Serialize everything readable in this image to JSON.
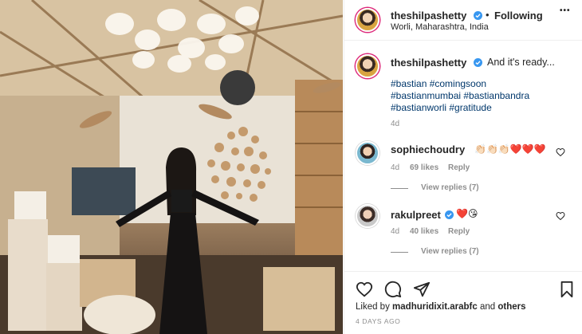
{
  "post": {
    "username": "theshilpashetty",
    "separator": "•",
    "follow_status": "Following",
    "location": "Worli, Maharashtra, India",
    "more_label": "•••"
  },
  "caption": {
    "username": "theshilpashetty",
    "text": "And it's ready...",
    "hashtags_line1": "#bastian #comingsoon",
    "hashtags_line2": "#bastianmumbai #bastianbandra",
    "hashtags_line3": "#bastianworli #gratitude",
    "age": "4d"
  },
  "comments": [
    {
      "username": "sophiechoudry",
      "text": "👏🏻👏🏻👏🏻❤️❤️❤️",
      "age": "4d",
      "likes": "69 likes",
      "reply": "Reply",
      "view_replies": "View replies (7)"
    },
    {
      "username": "rakulpreet",
      "text": "❤️😘",
      "age": "4d",
      "likes": "40 likes",
      "reply": "Reply",
      "view_replies": "View replies (7)"
    }
  ],
  "footer": {
    "liked_by_prefix": "Liked by",
    "liked_by_user": "madhuridixit.arabfc",
    "liked_by_and": "and",
    "liked_by_others": "others",
    "time_ago": "4 DAYS AGO"
  },
  "icons": {
    "verified": "verified-badge-icon",
    "more": "more-options-icon",
    "like": "heart-icon",
    "comment": "comment-icon",
    "share": "paper-plane-icon",
    "save": "bookmark-icon"
  },
  "colors": {
    "link": "#00376b",
    "verified": "#3897f0",
    "muted": "#8e8e8e",
    "story_ring": "#dd2a7b"
  }
}
